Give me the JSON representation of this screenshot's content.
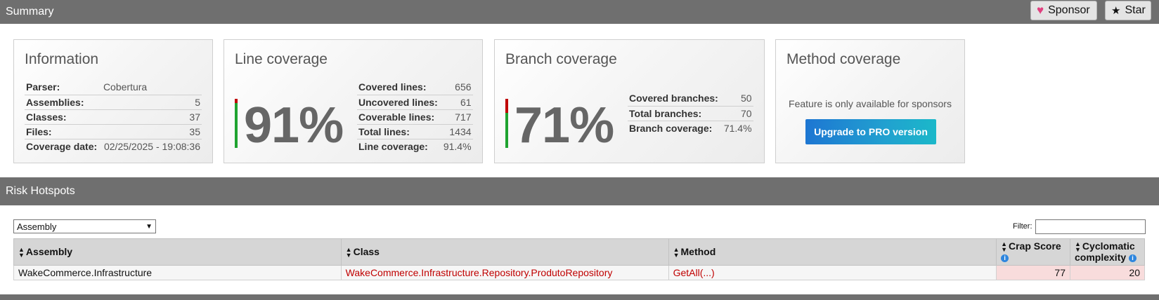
{
  "header": {
    "title": "Summary",
    "sponsor_label": "Sponsor",
    "star_label": "Star"
  },
  "information": {
    "title": "Information",
    "rows": [
      {
        "label": "Parser:",
        "value": "Cobertura"
      },
      {
        "label": "Assemblies:",
        "value": "5"
      },
      {
        "label": "Classes:",
        "value": "37"
      },
      {
        "label": "Files:",
        "value": "35"
      },
      {
        "label": "Coverage date:",
        "value": "02/25/2025 - 19:08:36"
      }
    ]
  },
  "line_coverage": {
    "title": "Line coverage",
    "percent": "91%",
    "fraction": 0.915,
    "rows": [
      {
        "label": "Covered lines:",
        "value": "656"
      },
      {
        "label": "Uncovered lines:",
        "value": "61"
      },
      {
        "label": "Coverable lines:",
        "value": "717"
      },
      {
        "label": "Total lines:",
        "value": "1434"
      },
      {
        "label": "Line coverage:",
        "value": "91.4%"
      }
    ]
  },
  "branch_coverage": {
    "title": "Branch coverage",
    "percent": "71%",
    "fraction": 0.714,
    "rows": [
      {
        "label": "Covered branches:",
        "value": "50"
      },
      {
        "label": "Total branches:",
        "value": "70"
      },
      {
        "label": "Branch coverage:",
        "value": "71.4%"
      }
    ]
  },
  "method_coverage": {
    "title": "Method coverage",
    "sponsor_text": "Feature is only available for sponsors",
    "upgrade_label": "Upgrade to PRO version"
  },
  "risk_hotspots": {
    "title": "Risk Hotspots",
    "grouping_value": "Assembly",
    "filter_label": "Filter:",
    "filter_value": "",
    "columns": {
      "assembly": "Assembly",
      "class": "Class",
      "method": "Method",
      "crap": "Crap Score",
      "cyclomatic_1": "Cyclomatic",
      "cyclomatic_2": "complexity"
    },
    "rows": [
      {
        "assembly": "WakeCommerce.Infrastructure",
        "class": "WakeCommerce.Infrastructure.Repository.ProdutoRepository",
        "method": "GetAll(...)",
        "crap": "77",
        "cyclomatic": "20"
      }
    ]
  },
  "colors": {
    "covered": "#1fa330",
    "uncovered": "#c00000",
    "header_bg": "#6f6f6f",
    "link": "#c00000",
    "risk_cell": "#f8dcdc"
  }
}
